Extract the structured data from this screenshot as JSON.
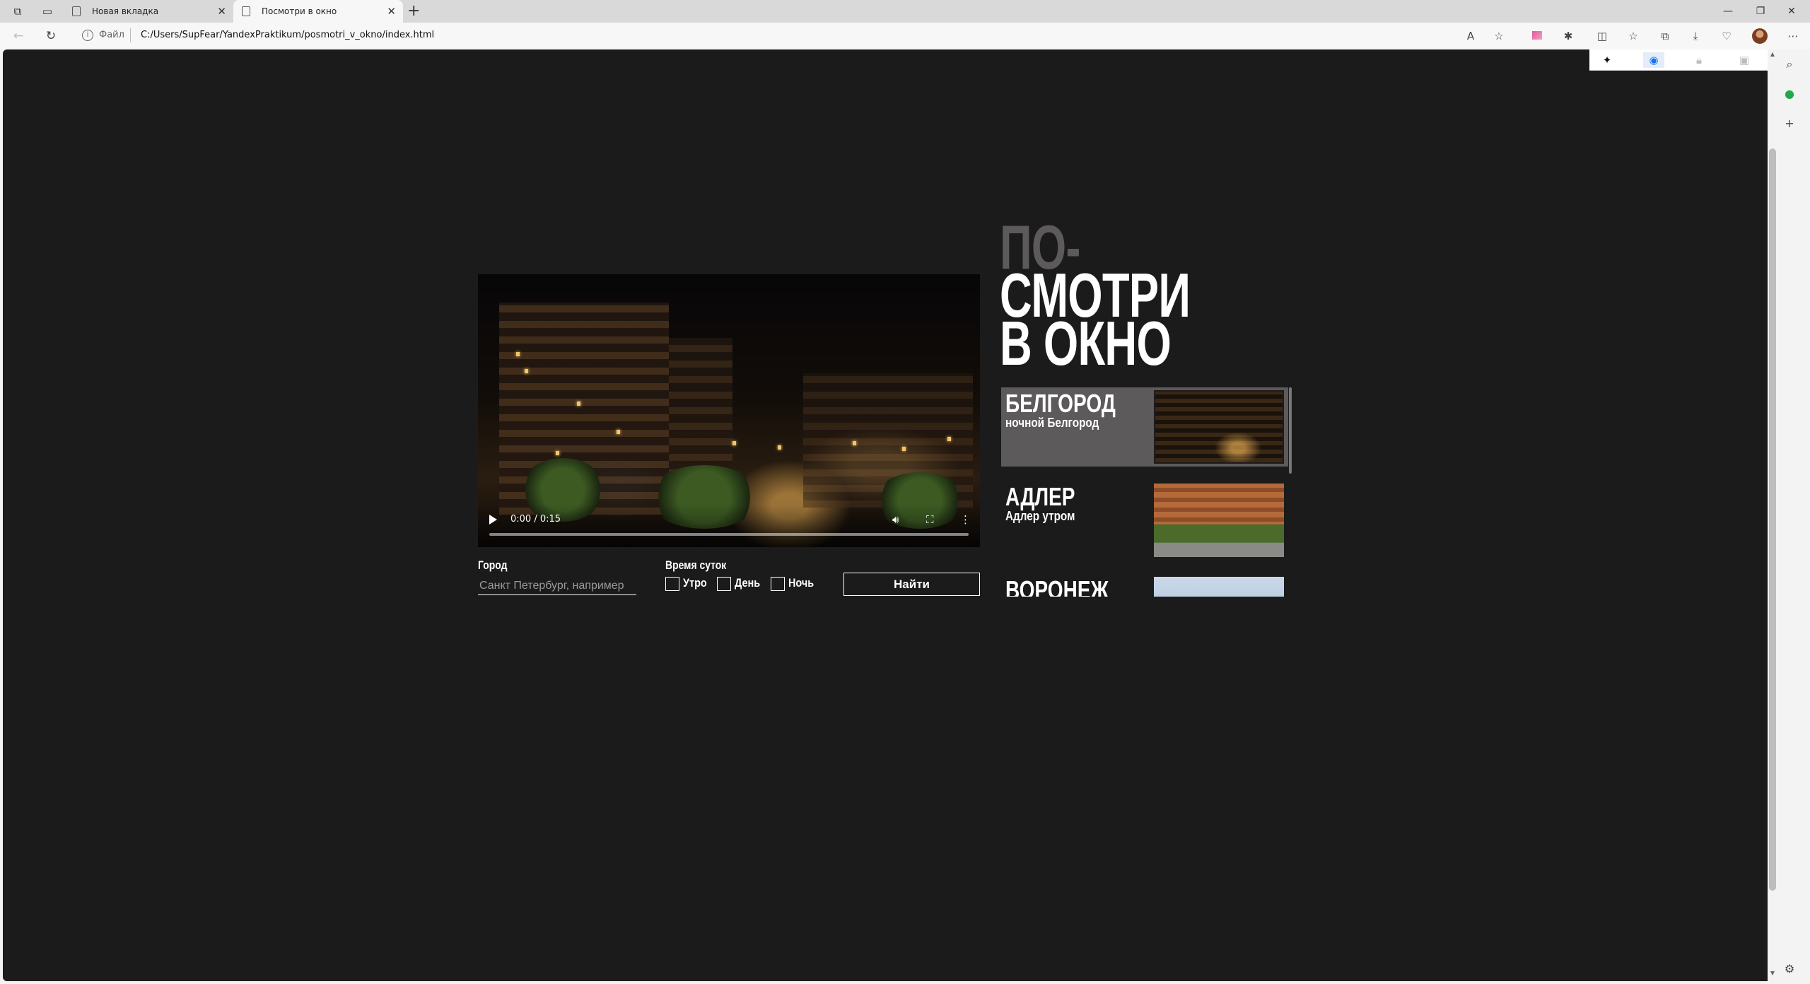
{
  "browser": {
    "tabs": [
      {
        "label": "Новая вкладка",
        "active": false
      },
      {
        "label": "Посмотри в окно",
        "active": true
      }
    ],
    "address": {
      "scheme_label": "Файл",
      "url": "C:/Users/SupFear/YandexPraktikum/posmotri_v_okno/index.html"
    }
  },
  "page": {
    "heading": {
      "line1": "ПО-",
      "line2": "СМОТРИ",
      "line3": "В ОКНО"
    },
    "video": {
      "time": "0:00 / 0:15",
      "progress": 0
    },
    "form": {
      "city_label": "Город",
      "city_placeholder": "Санкт Петербург, например",
      "time_label": "Время суток",
      "options": [
        {
          "label": "Утро",
          "checked": false
        },
        {
          "label": "День",
          "checked": false
        },
        {
          "label": "Ночь",
          "checked": false
        }
      ],
      "submit_label": "Найти"
    },
    "cities": [
      {
        "name": "БЕЛГОРОД",
        "desc": "ночной Белгород",
        "active": true
      },
      {
        "name": "АДЛЕР",
        "desc": "Адлер утром",
        "active": false
      },
      {
        "name": "ВОРОНЕЖ",
        "desc": "",
        "active": false
      }
    ]
  },
  "colors": {
    "page_bg": "#1c1b1c",
    "accent_gray": "#5c5a5b",
    "text": "#ffffff"
  }
}
